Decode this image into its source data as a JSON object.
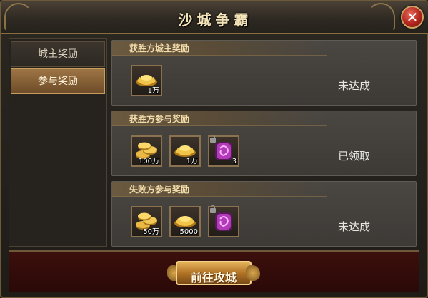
{
  "window": {
    "title": "沙城争霸"
  },
  "sidebar": {
    "tabs": [
      {
        "label": "城主奖励",
        "active": false
      },
      {
        "label": "参与奖励",
        "active": true
      }
    ]
  },
  "sections": [
    {
      "title": "获胜方城主奖励",
      "status": "未达成",
      "items": [
        {
          "icon": "gold-ingot-icon",
          "quantity": "1万"
        }
      ]
    },
    {
      "title": "获胜方参与奖励",
      "status": "已领取",
      "items": [
        {
          "icon": "gold-coins-icon",
          "quantity": "100万"
        },
        {
          "icon": "gold-ingot-icon",
          "quantity": "1万"
        },
        {
          "icon": "purple-gem-icon",
          "quantity": "3",
          "locked": true
        }
      ]
    },
    {
      "title": "失败方参与奖励",
      "status": "未达成",
      "items": [
        {
          "icon": "gold-coins-icon",
          "quantity": "50万"
        },
        {
          "icon": "gold-ingot-icon",
          "quantity": "5000"
        },
        {
          "icon": "purple-gem-icon",
          "quantity": "",
          "locked": true
        }
      ]
    }
  ],
  "footer": {
    "attack_button_label": "前往攻城"
  },
  "colors": {
    "title_text": "#f2e3b8",
    "section_title_text": "#f3dcaa",
    "active_tab": "#9d7444",
    "close_button": "#b0241c",
    "footer_bg": "#3c0f0c"
  }
}
